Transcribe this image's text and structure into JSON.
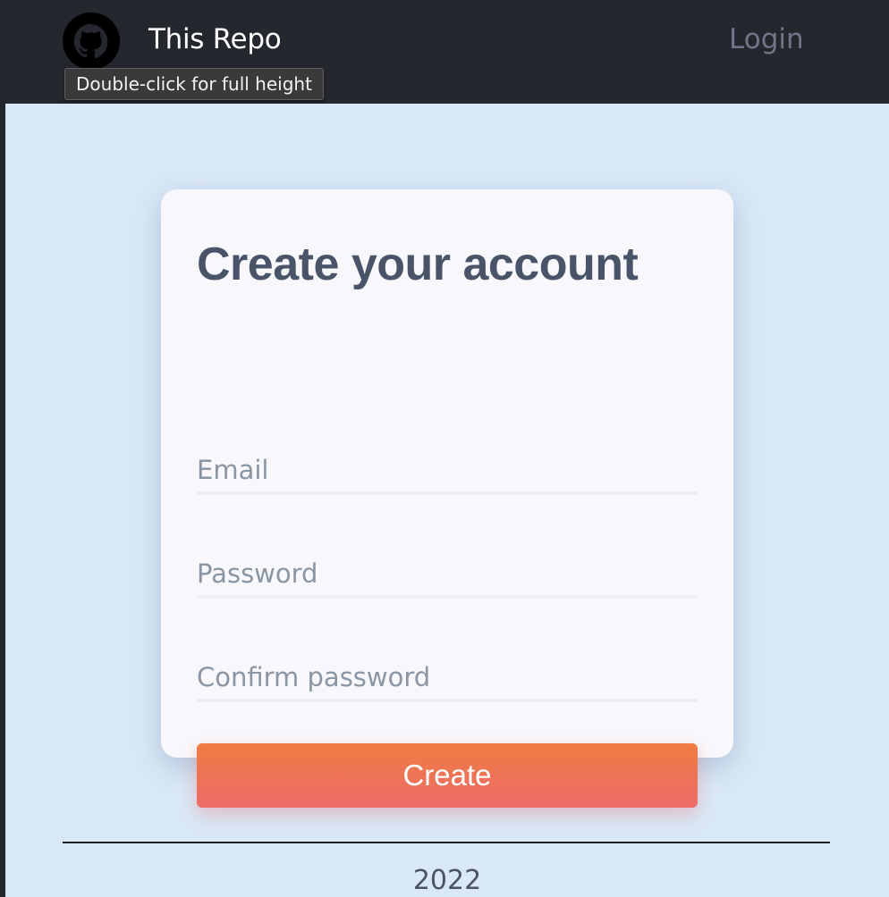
{
  "header": {
    "repo_title": "This Repo",
    "login_label": "Login",
    "logo_icon": "github-icon"
  },
  "tooltip": {
    "text": "Double-click for full height"
  },
  "form": {
    "title": "Create your account",
    "email_placeholder": "Email",
    "password_placeholder": "Password",
    "confirm_placeholder": "Confirm password",
    "submit_label": "Create"
  },
  "footer": {
    "year": "2022"
  },
  "colors": {
    "topbar": "#24272d",
    "background": "#d9e8f7",
    "card": "#f8f8fc",
    "button_gradient_start": "#f07c42",
    "button_gradient_end": "#ec6c68",
    "title_text": "#4a5468"
  }
}
